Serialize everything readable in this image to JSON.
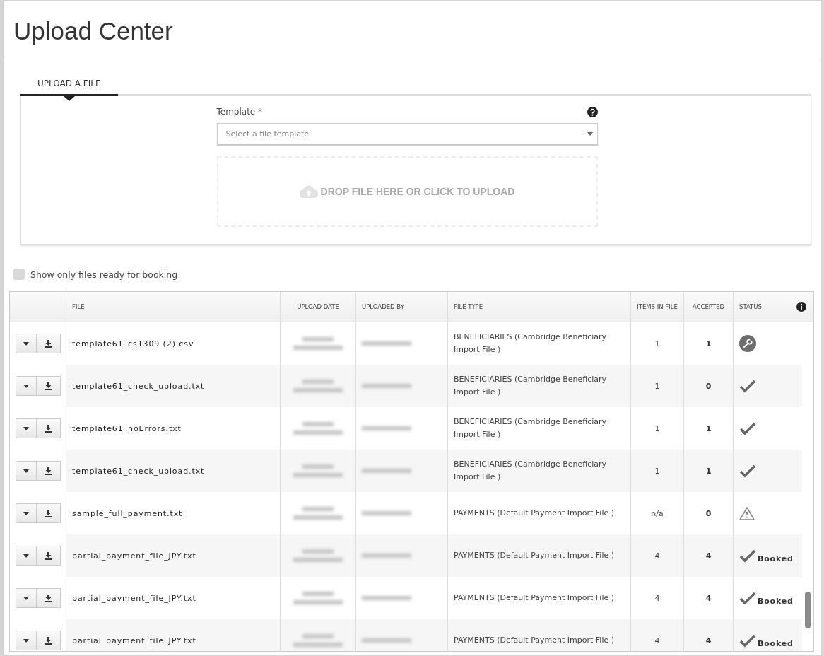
{
  "page_title": "Upload Center",
  "tabs": [
    {
      "label": "UPLOAD A FILE",
      "selected": true
    }
  ],
  "template": {
    "label": "Template",
    "required_mark": "*",
    "placeholder": "Select a file template"
  },
  "dropzone": {
    "text": "DROP FILE HERE OR CLICK TO UPLOAD"
  },
  "filter": {
    "label": "Show only files ready for booking",
    "checked": false
  },
  "table": {
    "columns": [
      "FILE",
      "UPLOAD DATE",
      "UPLOADED BY",
      "FILE TYPE",
      "ITEMS IN FILE",
      "ACCEPTED",
      "STATUS"
    ],
    "rows": [
      {
        "file": "template61_cs1309 (2).csv",
        "file_type": "BENEFICIARIES (Cambridge Beneficiary Import File )",
        "items": "1",
        "accepted": "1",
        "status": {
          "kind": "configure"
        }
      },
      {
        "file": "template61_check_upload.txt",
        "file_type": "BENEFICIARIES (Cambridge Beneficiary Import File )",
        "items": "1",
        "accepted": "0",
        "status": {
          "kind": "ok"
        }
      },
      {
        "file": "template61_noErrors.txt",
        "file_type": "BENEFICIARIES (Cambridge Beneficiary Import File )",
        "items": "1",
        "accepted": "1",
        "status": {
          "kind": "ok"
        }
      },
      {
        "file": "template61_check_upload.txt",
        "file_type": "BENEFICIARIES (Cambridge Beneficiary Import File )",
        "items": "1",
        "accepted": "1",
        "status": {
          "kind": "ok"
        }
      },
      {
        "file": "sample_full_payment.txt",
        "file_type": "PAYMENTS (Default Payment Import File )",
        "items": "n/a",
        "accepted": "0",
        "status": {
          "kind": "warning"
        }
      },
      {
        "file": "partial_payment_file_JPY.txt",
        "file_type": "PAYMENTS (Default Payment Import File )",
        "items": "4",
        "accepted": "4",
        "status": {
          "kind": "ok",
          "label": "Booked"
        }
      },
      {
        "file": "partial_payment_file_JPY.txt",
        "file_type": "PAYMENTS (Default Payment Import File )",
        "items": "4",
        "accepted": "4",
        "status": {
          "kind": "ok",
          "label": "Booked"
        }
      },
      {
        "file": "partial_payment_file_JPY.txt",
        "file_type": "PAYMENTS (Default Payment Import File )",
        "items": "4",
        "accepted": "4",
        "status": {
          "kind": "ok",
          "label": "Booked"
        }
      }
    ]
  }
}
